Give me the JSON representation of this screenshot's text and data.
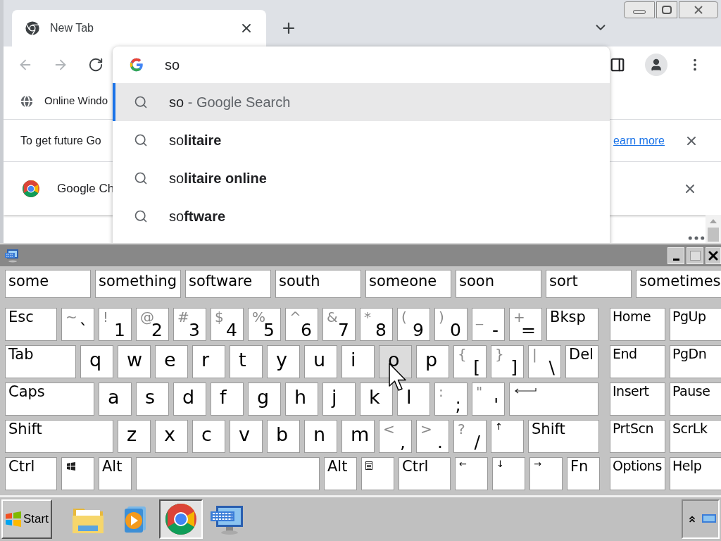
{
  "browser": {
    "tabs": [
      {
        "title": "New Tab",
        "selected": true
      }
    ],
    "bookmarks": [
      {
        "label": "Online Windo"
      }
    ],
    "infobar": {
      "text": "To get future Go",
      "link": "earn more"
    },
    "notice": {
      "text": "Google Ch"
    },
    "omnibox": {
      "value": "so",
      "suggestions": [
        {
          "kind": "search",
          "text": "so",
          "suffix": " - Google Search",
          "selected": true
        },
        {
          "kind": "search",
          "text": "so**litaire**",
          "selected": false
        },
        {
          "kind": "search",
          "text": "so**litaire online**",
          "selected": false
        },
        {
          "kind": "search",
          "text": "so**ftware**",
          "selected": false
        }
      ]
    }
  },
  "keyboard": {
    "predictions": [
      "some",
      "something",
      "software",
      "south",
      "someone",
      "soon",
      "sort",
      "sometimes"
    ],
    "rows": [
      {
        "keys": [
          {
            "kind": "label",
            "main": "Esc",
            "hovered": false
          },
          {
            "kind": "char",
            "shift": "~",
            "main": "`",
            "hovered": false
          },
          {
            "kind": "char",
            "shift": "!",
            "main": "1",
            "hovered": false
          },
          {
            "kind": "char",
            "shift": "@",
            "main": "2",
            "hovered": false
          },
          {
            "kind": "char",
            "shift": "#",
            "main": "3",
            "hovered": false
          },
          {
            "kind": "char",
            "shift": "$",
            "main": "4",
            "hovered": false
          },
          {
            "kind": "char",
            "shift": "%",
            "main": "5",
            "hovered": false
          },
          {
            "kind": "char",
            "shift": "^",
            "main": "6",
            "hovered": false
          },
          {
            "kind": "char",
            "shift": "&",
            "main": "7",
            "hovered": false
          },
          {
            "kind": "char",
            "shift": "*",
            "main": "8",
            "hovered": false
          },
          {
            "kind": "char",
            "shift": "(",
            "main": "9",
            "hovered": false
          },
          {
            "kind": "char",
            "shift": ")",
            "main": "0",
            "hovered": false
          },
          {
            "kind": "char",
            "shift": "_",
            "main": "-",
            "hovered": false
          },
          {
            "kind": "char",
            "shift": "+",
            "main": "=",
            "hovered": false
          },
          {
            "kind": "label",
            "main": "Bksp",
            "hovered": false
          }
        ]
      },
      {
        "keys": [
          {
            "kind": "label",
            "main": "Tab",
            "hovered": false
          },
          {
            "kind": "letter",
            "main": "q",
            "hovered": false
          },
          {
            "kind": "letter",
            "main": "w",
            "hovered": false
          },
          {
            "kind": "letter",
            "main": "e",
            "hovered": false
          },
          {
            "kind": "letter",
            "main": "r",
            "hovered": false
          },
          {
            "kind": "letter",
            "main": "t",
            "hovered": false
          },
          {
            "kind": "letter",
            "main": "y",
            "hovered": false
          },
          {
            "kind": "letter",
            "main": "u",
            "hovered": false
          },
          {
            "kind": "letter",
            "main": "i",
            "hovered": false
          },
          {
            "kind": "letter",
            "main": "o",
            "hovered": true
          },
          {
            "kind": "letter",
            "main": "p",
            "hovered": false
          },
          {
            "kind": "char",
            "shift": "{",
            "main": "[",
            "hovered": false
          },
          {
            "kind": "char",
            "shift": "}",
            "main": "]",
            "hovered": false
          },
          {
            "kind": "char",
            "shift": "|",
            "main": "\\",
            "hovered": false
          },
          {
            "kind": "label",
            "main": "Del",
            "hovered": false
          }
        ]
      },
      {
        "keys": [
          {
            "kind": "label",
            "main": "Caps",
            "hovered": false
          },
          {
            "kind": "letter",
            "main": "a",
            "hovered": false
          },
          {
            "kind": "letter",
            "main": "s",
            "hovered": false
          },
          {
            "kind": "letter",
            "main": "d",
            "hovered": false
          },
          {
            "kind": "letter",
            "main": "f",
            "hovered": false
          },
          {
            "kind": "letter",
            "main": "g",
            "hovered": false
          },
          {
            "kind": "letter",
            "main": "h",
            "hovered": false
          },
          {
            "kind": "letter",
            "main": "j",
            "hovered": false
          },
          {
            "kind": "letter",
            "main": "k",
            "hovered": false
          },
          {
            "kind": "letter",
            "main": "l",
            "hovered": false
          },
          {
            "kind": "char",
            "shift": ":",
            "main": ";",
            "hovered": false
          },
          {
            "kind": "char",
            "shift": "\"",
            "main": "'",
            "hovered": false
          },
          {
            "kind": "enter",
            "hovered": false
          }
        ]
      },
      {
        "keys": [
          {
            "kind": "label",
            "main": "Shift",
            "hovered": false
          },
          {
            "kind": "letter",
            "main": "z",
            "hovered": false
          },
          {
            "kind": "letter",
            "main": "x",
            "hovered": false
          },
          {
            "kind": "letter",
            "main": "c",
            "hovered": false
          },
          {
            "kind": "letter",
            "main": "v",
            "hovered": false
          },
          {
            "kind": "letter",
            "main": "b",
            "hovered": false
          },
          {
            "kind": "letter",
            "main": "n",
            "hovered": false
          },
          {
            "kind": "letter",
            "main": "m",
            "hovered": false
          },
          {
            "kind": "char",
            "shift": "<",
            "main": ",",
            "hovered": false
          },
          {
            "kind": "char",
            "shift": ">",
            "main": ".",
            "hovered": false
          },
          {
            "kind": "char",
            "shift": "?",
            "main": "/",
            "hovered": false
          },
          {
            "kind": "arrow",
            "main": "↑",
            "hovered": false
          },
          {
            "kind": "label",
            "main": "Shift",
            "hovered": false
          }
        ]
      },
      {
        "keys": [
          {
            "kind": "label",
            "main": "Ctrl",
            "hovered": false
          },
          {
            "kind": "windows",
            "hovered": false
          },
          {
            "kind": "label",
            "main": "Alt",
            "hovered": false
          },
          {
            "kind": "space",
            "hovered": false
          },
          {
            "kind": "label",
            "main": "Alt",
            "hovered": false
          },
          {
            "kind": "menu",
            "hovered": false
          },
          {
            "kind": "label",
            "main": "Ctrl",
            "hovered": false
          },
          {
            "kind": "arrow",
            "main": "←",
            "hovered": false
          },
          {
            "kind": "arrow",
            "main": "↓",
            "hovered": false
          },
          {
            "kind": "arrow",
            "main": "→",
            "hovered": false
          },
          {
            "kind": "label",
            "main": "Fn",
            "hovered": false
          }
        ]
      }
    ],
    "side": [
      [
        "Home",
        "PgUp"
      ],
      [
        "End",
        "PgDn"
      ],
      [
        "Insert",
        "Pause"
      ],
      [
        "PrtScn",
        "ScrLk"
      ],
      [
        "Options",
        "Help"
      ]
    ]
  },
  "taskbar": {
    "start": "Start",
    "items": [
      {
        "kind": "folder",
        "active": false
      },
      {
        "kind": "media",
        "active": false
      },
      {
        "kind": "chrome",
        "active": true
      },
      {
        "kind": "keyboard",
        "active": false
      }
    ]
  }
}
